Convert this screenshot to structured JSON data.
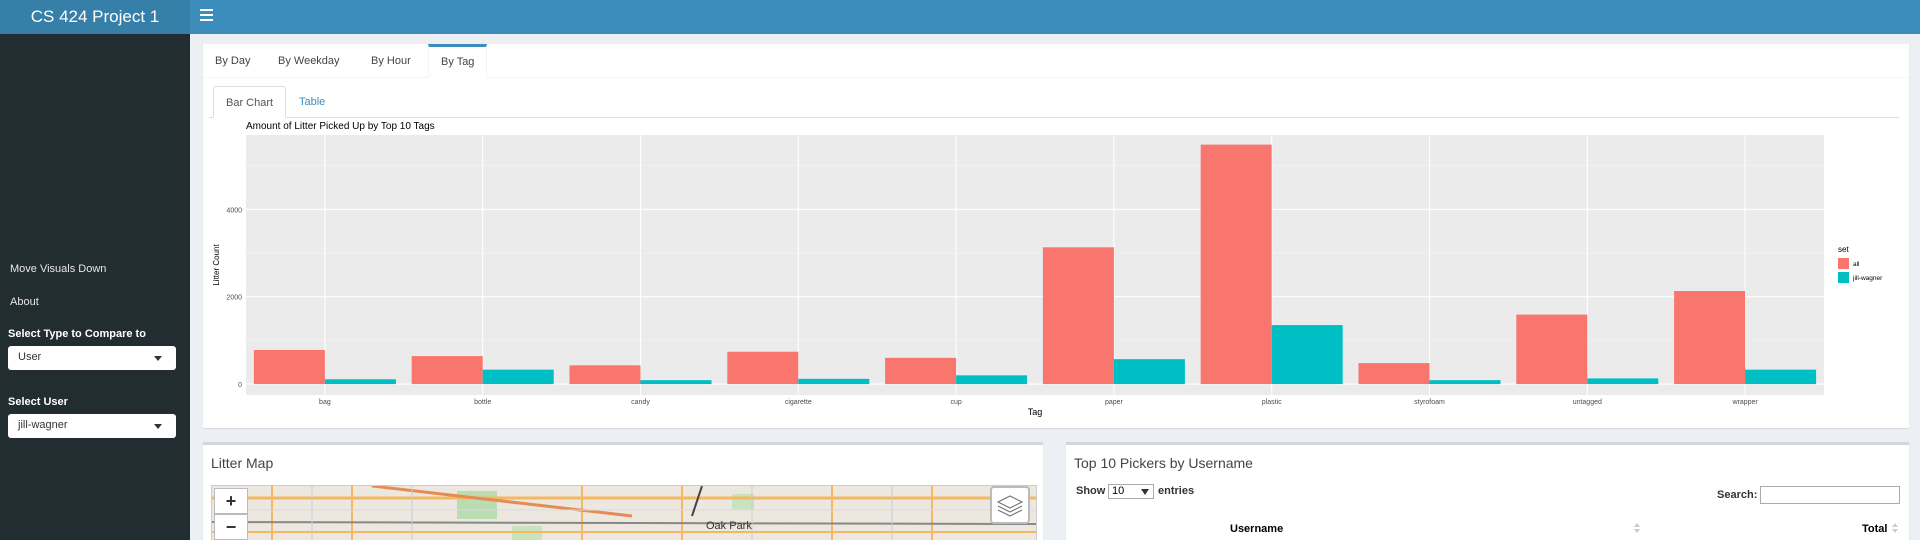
{
  "app": {
    "title": "CS 424 Project 1"
  },
  "sidebar": {
    "links": [
      {
        "label": "Move Visuals Down"
      },
      {
        "label": "About"
      }
    ],
    "compare_label": "Select Type to Compare to",
    "compare_value": "User",
    "user_label": "Select User",
    "user_value": "jill-wagner"
  },
  "tabs": {
    "main": [
      {
        "label": "By Day"
      },
      {
        "label": "By Weekday"
      },
      {
        "label": "By Hour"
      },
      {
        "label": "By Tag",
        "active": true
      }
    ],
    "sub": [
      {
        "label": "Bar Chart",
        "active": true
      },
      {
        "label": "Table"
      }
    ]
  },
  "chart_data": {
    "type": "bar",
    "title": "Amount of Litter Picked Up by Top 10 Tags",
    "xlabel": "Tag",
    "ylabel": "Litter Count",
    "categories": [
      "bag",
      "bottle",
      "candy",
      "cigarette",
      "cup",
      "paper",
      "plastic",
      "styrofoam",
      "untagged",
      "wrapper"
    ],
    "series": [
      {
        "name": "all",
        "color": "#f8766d",
        "values": [
          780,
          640,
          430,
          740,
          600,
          3130,
          5480,
          480,
          1590,
          2130
        ]
      },
      {
        "name": "jill-wagner",
        "color": "#00bfc4",
        "values": [
          110,
          330,
          90,
          120,
          200,
          570,
          1350,
          90,
          130,
          330
        ]
      }
    ],
    "ylim": [
      -250,
      5700
    ],
    "yticks": [
      0,
      2000,
      4000
    ],
    "legend_title": "set",
    "legend_position": "right",
    "grid": true
  },
  "map": {
    "title": "Litter Map",
    "zoom_in": "+",
    "zoom_out": "−",
    "layers_icon": "layers-icon",
    "place_label": "Oak Park"
  },
  "pickers": {
    "title": "Top 10 Pickers by Username",
    "show_label": "Show",
    "entries_value": "10",
    "entries_label": "entries",
    "search_label": "Search:",
    "search_value": "",
    "columns": [
      "Username",
      "Total"
    ]
  }
}
